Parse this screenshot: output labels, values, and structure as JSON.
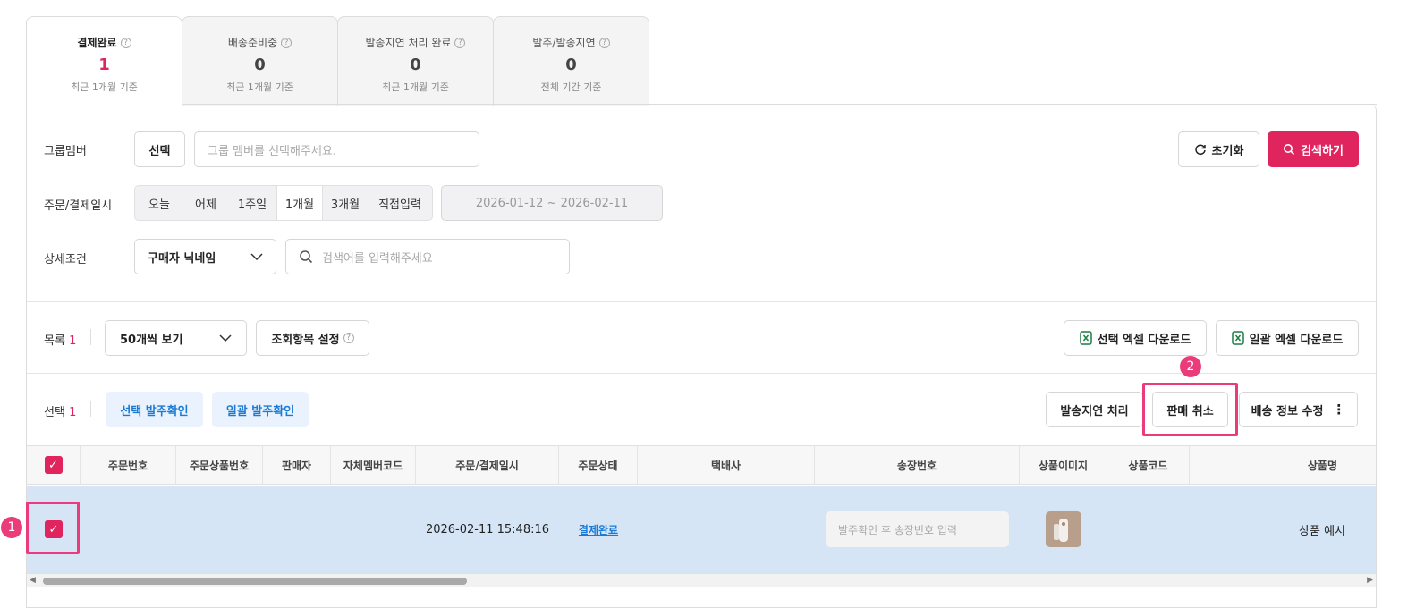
{
  "tabs": [
    {
      "title": "결제완료",
      "count": "1",
      "sub": "최근 1개월 기준",
      "active": true
    },
    {
      "title": "배송준비중",
      "count": "0",
      "sub": "최근 1개월 기준"
    },
    {
      "title": "발송지연 처리 완료",
      "count": "0",
      "sub": "최근 1개월 기준"
    },
    {
      "title": "발주/발송지연",
      "count": "0",
      "sub": "전체 기간 기준"
    }
  ],
  "filters": {
    "group_label": "그룹멤버",
    "group_select_btn": "선택",
    "group_placeholder": "그룹 멤버를 선택해주세요.",
    "reset_btn": "초기화",
    "search_btn": "검색하기",
    "date_label": "주문/결제일시",
    "date_options": [
      "오늘",
      "어제",
      "1주일",
      "1개월",
      "3개월",
      "직접입력"
    ],
    "date_selected": "1개월",
    "date_range": "2026-01-12 ~ 2026-02-11",
    "detail_label": "상세조건",
    "detail_select": "구매자 닉네임",
    "keyword_placeholder": "검색어를 입력해주세요"
  },
  "list": {
    "count_label": "목록",
    "count": "1",
    "page_size": "50개씩 보기",
    "columns_btn": "조회항목 설정",
    "excel_selected_btn": "선택 엑셀 다운로드",
    "excel_all_btn": "일괄 엑셀 다운로드"
  },
  "actions": {
    "selected_label": "선택",
    "selected_count": "1",
    "confirm_selected": "선택 발주확인",
    "confirm_all": "일괄 발주확인",
    "delay_btn": "발송지연 처리",
    "cancel_btn": "판매 취소",
    "shipping_btn": "배송 정보 수정"
  },
  "table": {
    "headers": [
      "주문번호",
      "주문상품번호",
      "판매자",
      "자체멤버코드",
      "주문/결제일시",
      "주문상태",
      "택배사",
      "송장번호",
      "상품이미지",
      "상품코드",
      "상품명"
    ],
    "row": {
      "datetime": "2026-02-11 15:48:16",
      "status": "결제완료",
      "invoice_placeholder": "발주확인 후 송장번호 입력",
      "product_name": "상품 예시"
    }
  },
  "annotations": {
    "badge1": "1",
    "badge2": "2"
  },
  "colors": {
    "accent": "#e0245e",
    "highlight": "#ea3c7a",
    "row_selected": "#d5e5f6",
    "link": "#1a7bd6"
  }
}
